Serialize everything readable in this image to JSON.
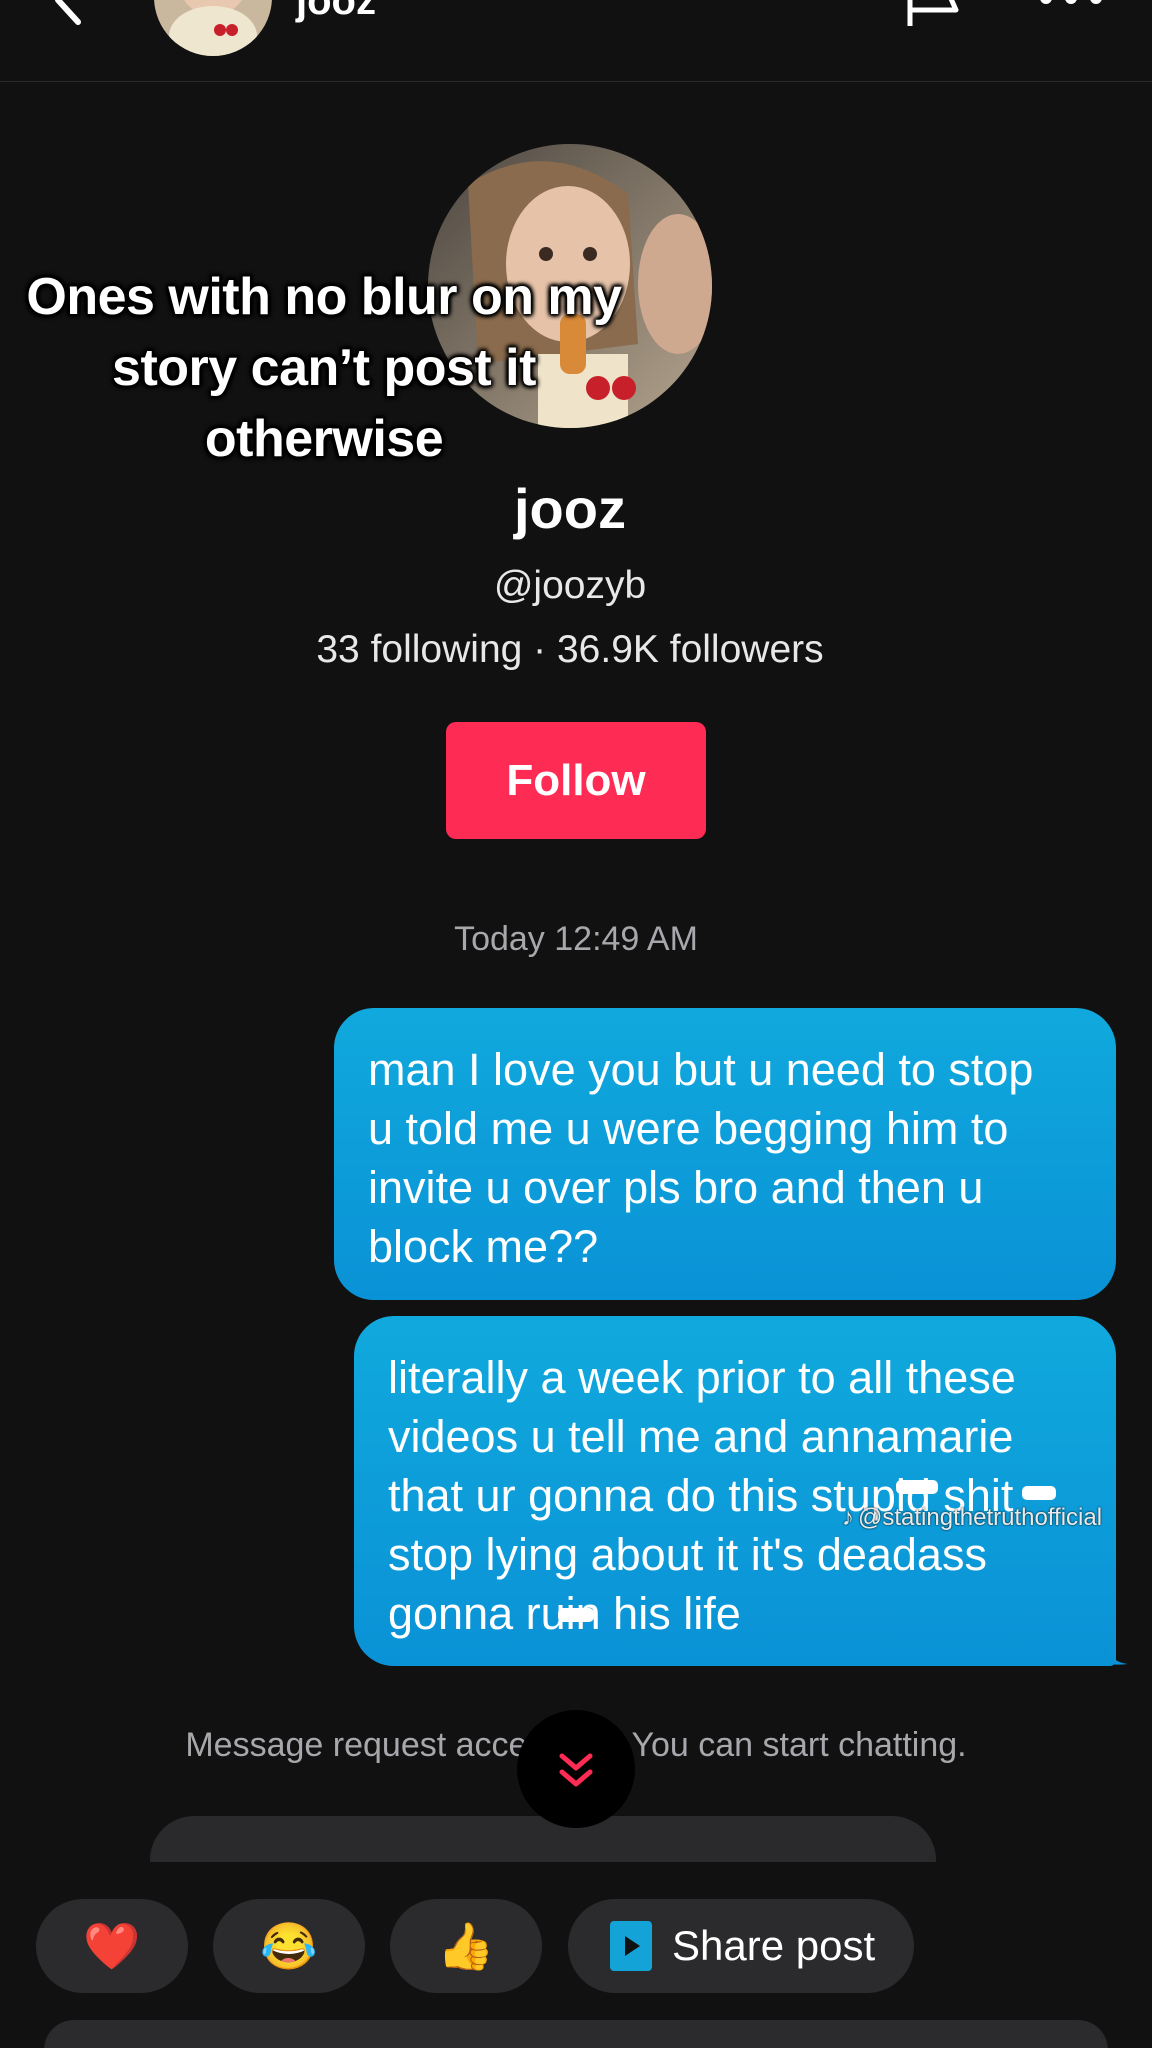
{
  "header": {
    "title": "jooz",
    "back_icon": "chevron-left-icon",
    "flag_icon": "flag-icon",
    "more_icon": "more-horizontal-icon"
  },
  "overlay_caption": [
    "Ones with no blur on my",
    "story can’t post it",
    "otherwise"
  ],
  "profile": {
    "name": "jooz",
    "handle": "@joozyb",
    "stats": "33 following · 36.9K followers",
    "follow_label": "Follow"
  },
  "chat": {
    "timestamp": "Today 12:49 AM",
    "messages": [
      {
        "lines": [
          "man I love you but u need to stop",
          "u told me u were begging him to",
          "invite u over pls bro and then u",
          "block me??"
        ]
      },
      {
        "lines": [
          "literally a week prior to all these",
          "videos u tell me and annamarie",
          "that ur gonna do this stupid shit",
          "stop lying about it it's deadass",
          "gonna ruin his life"
        ]
      }
    ],
    "watermark": "@statingthetruthofficial",
    "system_note_left": "Message request acce",
    "system_note_right": "You can start chatting."
  },
  "reactions": [
    "❤️",
    "😂",
    "👍"
  ],
  "share_label": "Share post",
  "colors": {
    "background": "#111112",
    "accent": "#fe2c55",
    "bubble": "#0a9fd9",
    "chip": "#2b2b2d"
  }
}
